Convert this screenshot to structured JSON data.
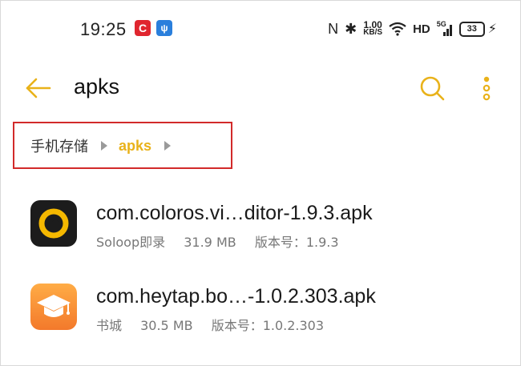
{
  "status_bar": {
    "time": "19:25",
    "badge_c": "C",
    "badge_usb": "ψ",
    "nfc_glyph": "Ν",
    "bluetooth_glyph": "✱",
    "speed_value": "1.00",
    "speed_unit": "KB/S",
    "hd_label": "HD",
    "signal_type": "5G",
    "battery_level": "33"
  },
  "app_bar": {
    "title": "apks"
  },
  "breadcrumb": {
    "root": "手机存储",
    "current": "apks"
  },
  "files": [
    {
      "name": "com.coloros.vi…ditor-1.9.3.apk",
      "app_name": "Soloop即录",
      "size": "31.9 MB",
      "version": "版本号：1.9.3",
      "icon": "soloop-app-icon"
    },
    {
      "name": "com.heytap.bo…-1.0.2.303.apk",
      "app_name": "书城",
      "size": "30.5 MB",
      "version": "版本号：1.0.2.303",
      "icon": "books-app-icon"
    }
  ],
  "colors": {
    "accent": "#e9b21a",
    "highlight_box": "#d22a2a",
    "secondary_text": "#777777"
  }
}
